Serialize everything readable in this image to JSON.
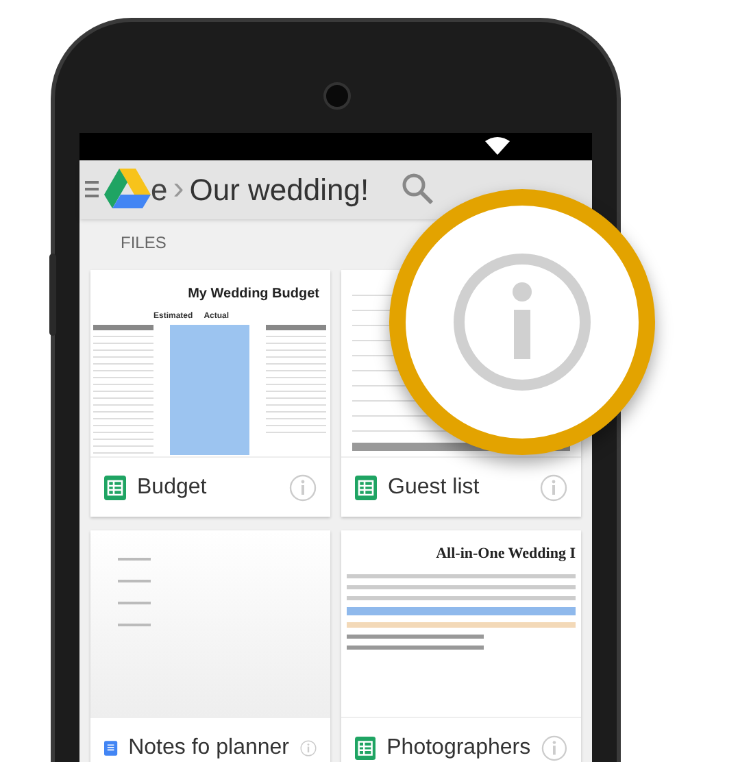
{
  "app_bar": {
    "breadcrumb_tail": "e",
    "separator": "›",
    "title": "Our wedding!"
  },
  "section_label": "FILES",
  "files": [
    {
      "name": "Budget",
      "kind": "sheet",
      "preview": {
        "kind": "budget",
        "title": "My Wedding Budget",
        "column_1": "Estimated",
        "column_2": "Actual"
      }
    },
    {
      "name": "Guest list",
      "kind": "sheet",
      "preview": {
        "kind": "guests"
      }
    },
    {
      "name": "Notes fo  planner",
      "kind": "doc",
      "preview": {
        "kind": "notes"
      }
    },
    {
      "name": "Photographers",
      "kind": "sheet",
      "preview": {
        "kind": "planner",
        "title": "All-in-One Wedding I"
      }
    }
  ]
}
